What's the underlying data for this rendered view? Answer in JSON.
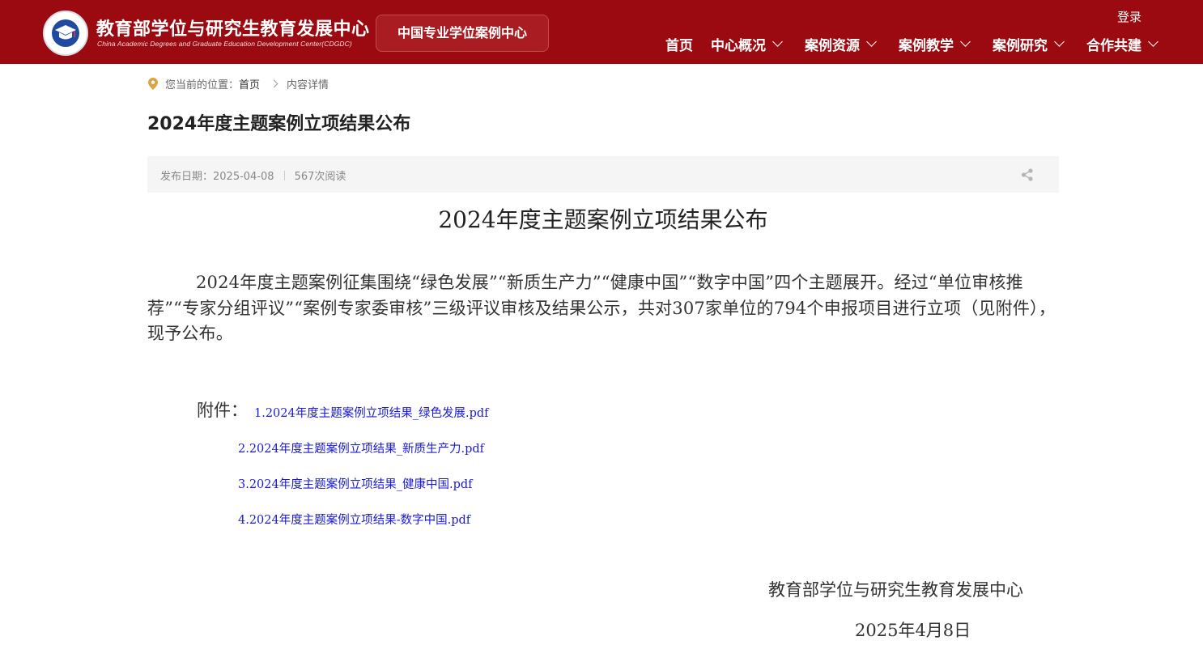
{
  "header": {
    "brand_cn": "教育部学位与研究生教育发展中心",
    "brand_en": "China Academic Degrees and Graduate Education Development Center(CDGDC)",
    "subsite": "中国专业学位案例中心",
    "login": "登录",
    "nav": [
      "首页",
      "中心概况",
      "案例资源",
      "案例教学",
      "案例研究",
      "合作共建"
    ]
  },
  "breadcrumb": {
    "prefix": "您当前的位置：",
    "home": "首页",
    "current": "内容详情"
  },
  "page_title": "2024年度主题案例立项结果公布",
  "meta": {
    "date": "发布日期：2025-04-08",
    "reads": "567次阅读"
  },
  "article": {
    "title": "2024年度主题案例立项结果公布",
    "body": "2024年度主题案例征集围绕“绿色发展”“新质生产力”“健康中国”“数字中国”四个主题展开。经过“单位审核推荐”“专家分组评议”“案例专家委审核”三级评议审核及结果公示，共对307家单位的794个申报项目进行立项（见附件），现予公布。",
    "attach_label": "附件：",
    "attachments": [
      "1.2024年度主题案例立项结果_绿色发展.pdf",
      "2.2024年度主题案例立项结果_新质生产力.pdf",
      "3.2024年度主题案例立项结果_健康中国.pdf",
      "4.2024年度主题案例立项结果-数字中国.pdf"
    ],
    "sign_org": "教育部学位与研究生教育发展中心",
    "sign_date": "2025年4月8日"
  },
  "colors": {
    "header_bg": "#9b0a10",
    "link": "#1a1ad4",
    "pin": "#d9a441"
  },
  "icons": {
    "location": "location-pin-icon",
    "share": "share-icon",
    "chevron": "chevron-down-icon"
  }
}
